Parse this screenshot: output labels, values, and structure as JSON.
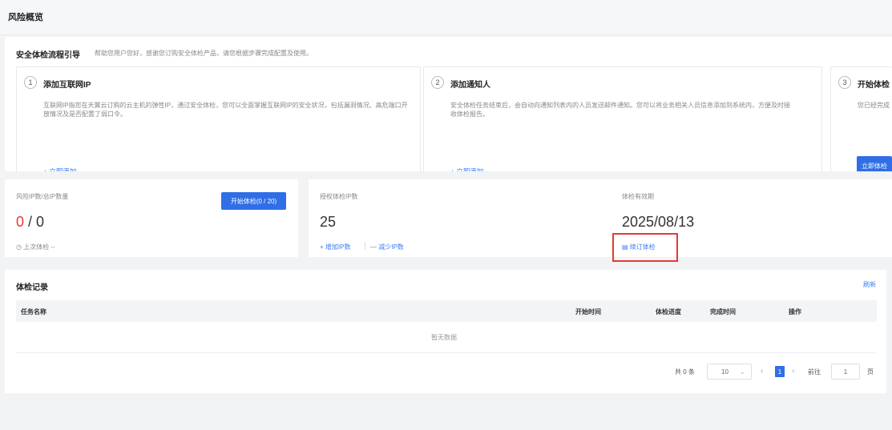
{
  "header": {
    "title": "风险概览"
  },
  "guide": {
    "title": "安全体检流程引导",
    "desc": "帮助您用户您好，感谢您订购安全体检产品，请您根据步骤完成配置及使用。",
    "steps": [
      {
        "num": "1",
        "title": "添加互联网IP",
        "text": "互联网IP指您在天翼云订购的云主机的弹性IP，通过安全体检，您可以全面掌握互联网IP的安全状况，包括漏洞情况、高危端口开放情况及是否配置了弱口令。",
        "action": "+ 立即添加"
      },
      {
        "num": "2",
        "title": "添加通知人",
        "text": "安全体检任务结束后，会自动向通知列表内的人员发送邮件通知。您可以将业务相关人员信息添加到系统内，方便及时接收体检报告。",
        "action": "+ 立即添加"
      },
      {
        "num": "3",
        "title": "开始体检",
        "text": "您已经完成",
        "action": "立即体检"
      }
    ]
  },
  "stats": {
    "risk": {
      "label": "风险IP数/总IP数量",
      "value_red": "0",
      "value_rest": " / 0",
      "button": "开始体检(0 / 20)",
      "last_check": "上次体检 --"
    },
    "auth": {
      "label": "授权体检IP数",
      "value": "25",
      "add": "+ 增加IP数",
      "reduce": "— 减少IP数"
    },
    "valid": {
      "label": "体检有效期",
      "value": "2025/08/13",
      "renew": "续订体检"
    }
  },
  "records": {
    "title": "体检记录",
    "refresh": "刷新",
    "columns": [
      "任务名称",
      "开始时间",
      "体检进度",
      "完成时间",
      "操作"
    ],
    "empty_text": "暂无数据",
    "pagination": {
      "total": "共 0 条",
      "page_size": "10",
      "current_page": "1",
      "goto_label": "前往",
      "goto_value": "1",
      "page_suffix": "页"
    }
  },
  "colors": {
    "accent": "#2f6ee6",
    "link": "#3a7cf5",
    "danger": "#e53935",
    "highlight": "#e53935"
  }
}
